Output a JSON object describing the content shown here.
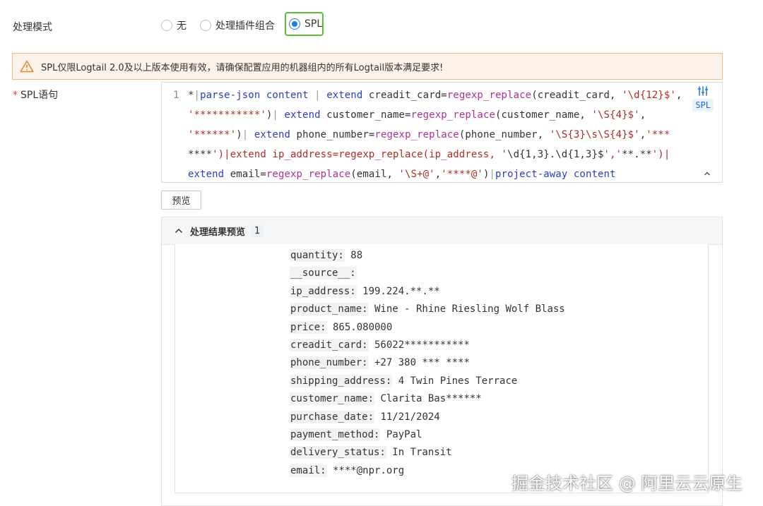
{
  "mode": {
    "label": "处理模式",
    "options": [
      {
        "label": "无",
        "selected": false
      },
      {
        "label": "处理插件组合",
        "selected": false
      },
      {
        "label": "SPL",
        "selected": true
      }
    ]
  },
  "warning": {
    "icon": "warning-triangle-icon",
    "text": "SPL仅限Logtail 2.0及以上版本使用有效，请确保配置应用的机器组内的所有Logtail版本满足要求!"
  },
  "spl": {
    "label": "SPL语句",
    "required_mark": "*",
    "line_number": "1",
    "badge": "SPL",
    "code": [
      "*|parse-json content | extend creadit_card=regexp_replace(creadit_card, '\\d{12}$',",
      "'***********')| extend customer_name=regexp_replace(customer_name, '\\S{4}$',",
      "'******')| extend phone_number=regexp_replace(phone_number, '\\S{3}\\s\\S{4}$','***",
      "****')|extend ip_address=regexp_replace(ip_address, '\\d{1,3}.\\d{1,3}$','**.**')|",
      "extend email=regexp_replace(email, '\\S+@','****@')|project-away content"
    ]
  },
  "preview_button": "预览",
  "result": {
    "title": "处理结果预览",
    "count": "1",
    "fields": [
      {
        "key": "quantity:",
        "value": "88"
      },
      {
        "key": "__source__:",
        "value": ""
      },
      {
        "key": "ip_address:",
        "value": "199.224.**.**"
      },
      {
        "key": "product_name:",
        "value": "Wine - Rhine Riesling Wolf Blass"
      },
      {
        "key": "price:",
        "value": "865.080000"
      },
      {
        "key": "creadit_card:",
        "value": "56022***********"
      },
      {
        "key": "phone_number:",
        "value": "+27 380 *** ****"
      },
      {
        "key": "shipping_address:",
        "value": "4 Twin Pines Terrace"
      },
      {
        "key": "customer_name:",
        "value": "Clarita Bas******"
      },
      {
        "key": "purchase_date:",
        "value": "11/21/2024"
      },
      {
        "key": "payment_method:",
        "value": "PayPal"
      },
      {
        "key": "delivery_status:",
        "value": "In Transit"
      },
      {
        "key": "email:",
        "value": "****@npr.org"
      }
    ]
  },
  "watermark": "掘金技术社区 @ 阿里云云原生"
}
